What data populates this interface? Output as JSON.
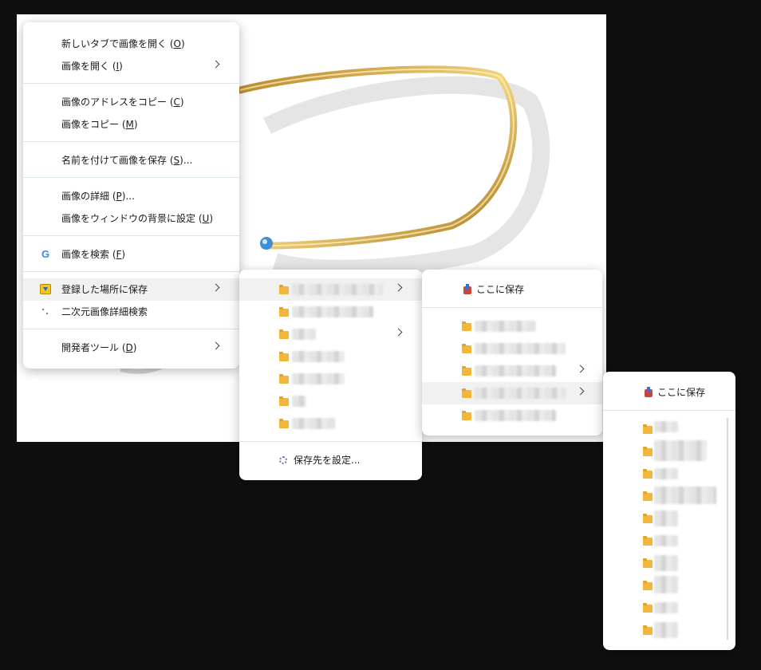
{
  "menu": {
    "items": [
      {
        "label": "新しいタブで画像を開く",
        "key": "O",
        "suffix": ""
      },
      {
        "label": "画像を開く",
        "key": "I",
        "suffix": ""
      },
      {
        "label": "画像のアドレスをコピー",
        "key": "C",
        "suffix": ""
      },
      {
        "label": "画像をコピー",
        "key": "M",
        "suffix": ""
      },
      {
        "label": "名前を付けて画像を保存",
        "key": "S",
        "suffix": "..."
      },
      {
        "label": "画像の詳細",
        "key": "P",
        "suffix": "..."
      },
      {
        "label": "画像をウィンドウの背景に設定",
        "key": "U",
        "suffix": ""
      },
      {
        "label": "画像を検索",
        "key": "F",
        "suffix": ""
      },
      {
        "label": "登録した場所に保存",
        "key": "",
        "suffix": ""
      },
      {
        "label": "二次元画像詳細検索",
        "key": "",
        "suffix": ""
      },
      {
        "label": "開発者ツール",
        "key": "D",
        "suffix": ""
      }
    ]
  },
  "submenu1": {
    "set_destination_label": "保存先を設定..."
  },
  "submenu2": {
    "save_here_label": "ここに保存"
  },
  "submenu3": {
    "save_here_label": "ここに保存"
  },
  "icons": {
    "google": "google-icon",
    "favorites": "favorite-folder-icon",
    "image_search": "image-search-icon",
    "folder": "folder-icon",
    "save_here": "save-here-icon",
    "settings": "gear-icon",
    "submenu": "chevron-right-icon"
  },
  "colors": {
    "background": "#0f0f0f",
    "menu": "#ffffff",
    "highlight": "#f1f1f1",
    "separator": "#dbe6ec",
    "folder": "#f3b63d"
  }
}
